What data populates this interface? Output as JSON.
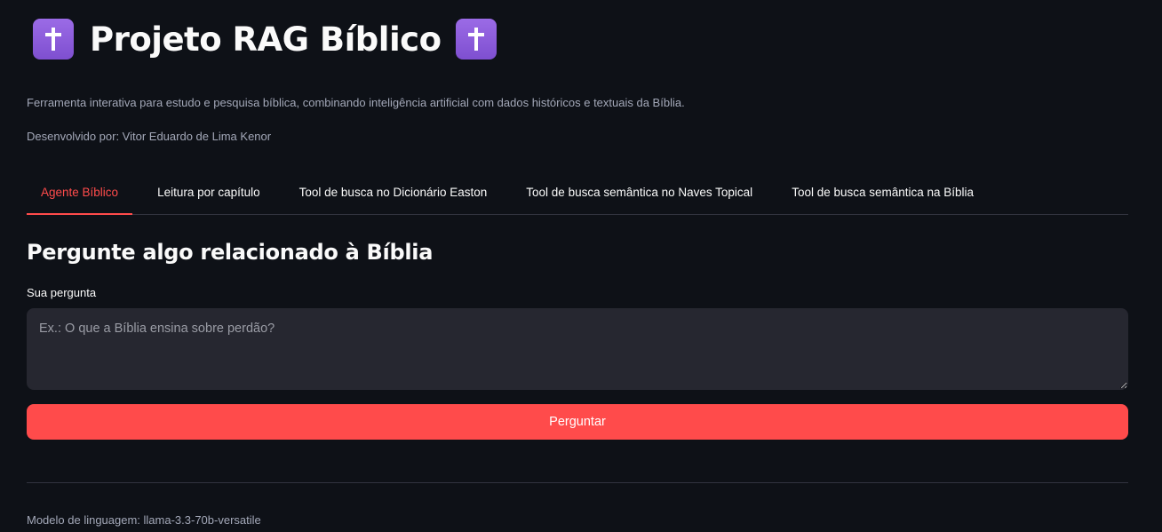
{
  "header": {
    "title": "Projeto RAG Bíblico",
    "title_icon": "latin-cross-icon",
    "subtitle": "Ferramenta interativa para estudo e pesquisa bíblica, combinando inteligência artificial com dados históricos e textuais da Bíblia.",
    "author": "Desenvolvido por: Vitor Eduardo de Lima Kenor"
  },
  "tabs": [
    {
      "label": "Agente Bíblico",
      "active": true
    },
    {
      "label": "Leitura por capítulo",
      "active": false
    },
    {
      "label": "Tool de busca no Dicionário Easton",
      "active": false
    },
    {
      "label": "Tool de busca semântica no Naves Topical",
      "active": false
    },
    {
      "label": "Tool de busca semântica na Bíblia",
      "active": false
    }
  ],
  "main": {
    "heading": "Pergunte algo relacionado à Bíblia",
    "question_label": "Sua pergunta",
    "question_value": "",
    "question_placeholder": "Ex.: O que a Bíblia ensina sobre perdão?",
    "ask_button": "Perguntar"
  },
  "footer": {
    "model_info": "Modelo de linguagem: llama-3.3-70b-versatile"
  },
  "colors": {
    "background": "#0e1117",
    "accent": "#ff4b4b",
    "input_background": "#262730",
    "icon_purple": "#8a5cd6"
  }
}
